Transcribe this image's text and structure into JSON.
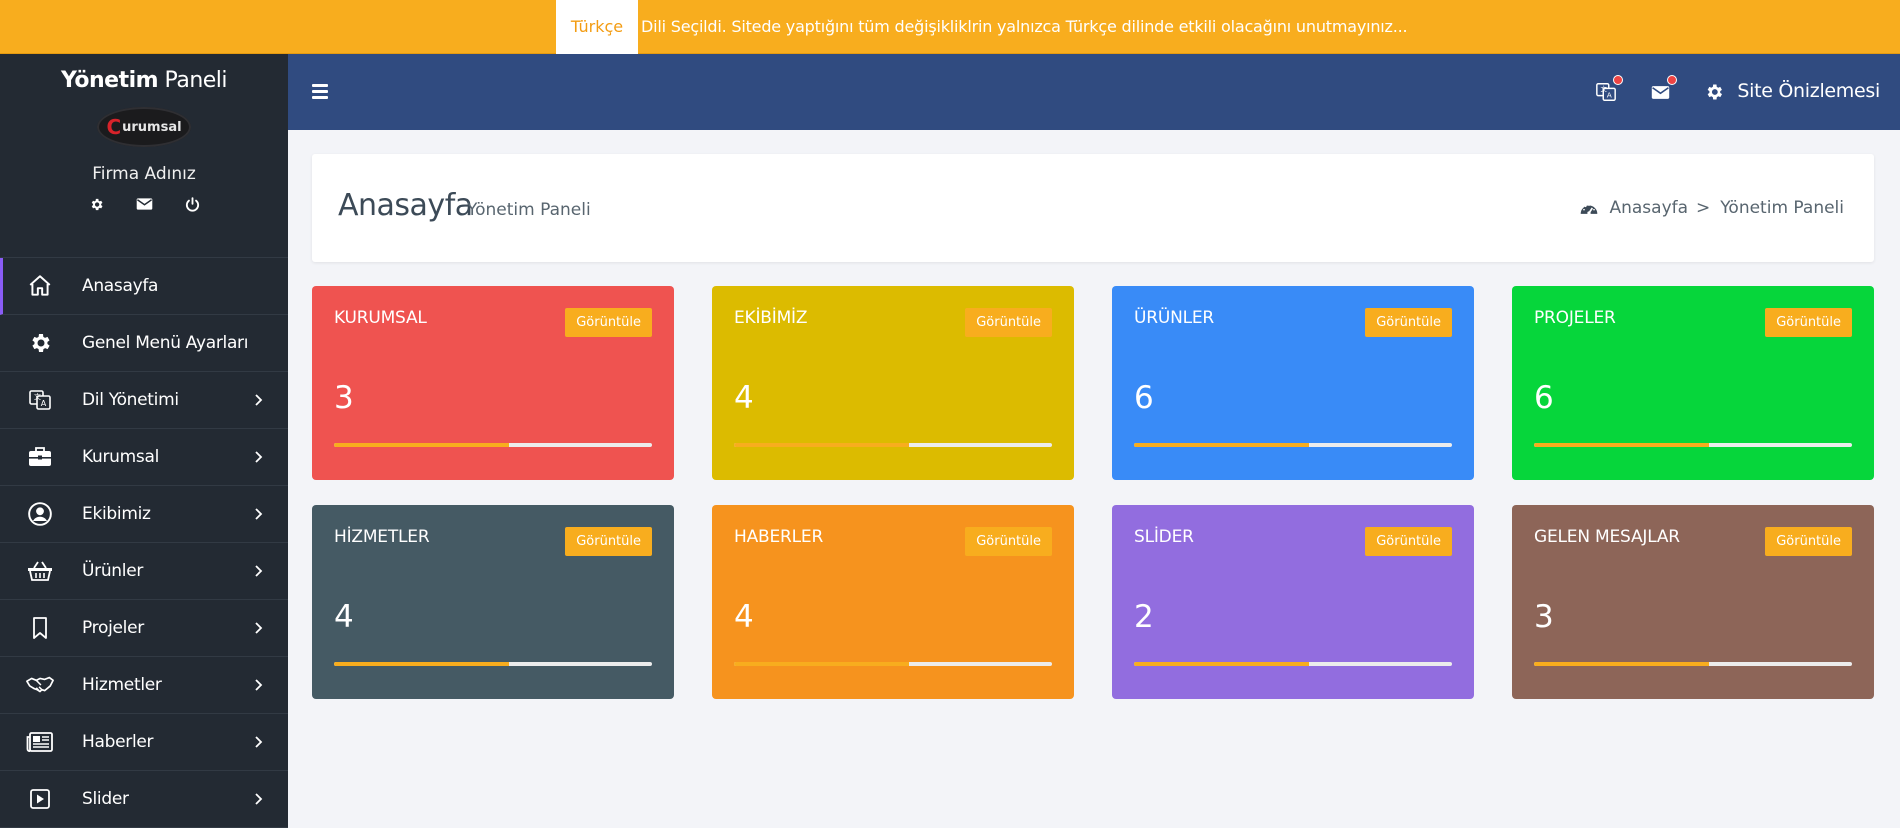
{
  "notice": {
    "lang": "Türkçe",
    "message": "Dili Seçildi. Sitede yaptığını tüm değişikliklrin yalnızca Türkçe dilinde etkili olacağını unutmayınız..."
  },
  "sidebar": {
    "title_bold": "Yönetim",
    "title_rest": " Paneli",
    "logo_mark": "C",
    "logo_text": "urumsal",
    "firm_name": "Firma Adınız",
    "items": [
      {
        "label": "Anasayfa",
        "icon": "home-icon"
      },
      {
        "label": "Genel Menü Ayarları",
        "icon": "gear-icon"
      },
      {
        "label": "Dil Yönetimi",
        "icon": "translate-icon"
      },
      {
        "label": "Kurumsal",
        "icon": "briefcase-icon"
      },
      {
        "label": "Ekibimiz",
        "icon": "user-circle-icon"
      },
      {
        "label": "Ürünler",
        "icon": "basket-icon"
      },
      {
        "label": "Projeler",
        "icon": "bookmark-icon"
      },
      {
        "label": "Hizmetler",
        "icon": "handshake-icon"
      },
      {
        "label": "Haberler",
        "icon": "newspaper-icon"
      },
      {
        "label": "Slider",
        "icon": "play-square-icon"
      }
    ]
  },
  "header": {
    "preview_label": "Site Önizlemesi"
  },
  "page": {
    "title": "Anasayfa",
    "subtitle": "Yönetim Paneli",
    "breadcrumb": [
      "Anasayfa",
      ">",
      "Yönetim Paneli"
    ]
  },
  "cards": [
    {
      "name": "KURUMSAL",
      "count": "3",
      "button": "Görüntüle",
      "color": "#ef5350",
      "progress": 0.55
    },
    {
      "name": "EKİBİMİZ",
      "count": "4",
      "button": "Görüntüle",
      "color": "#dcbb00",
      "progress": 0.55
    },
    {
      "name": "ÜRÜNLER",
      "count": "6",
      "button": "Görüntüle",
      "color": "#398bf7",
      "progress": 0.55
    },
    {
      "name": "PROJELER",
      "count": "6",
      "button": "Görüntüle",
      "color": "#06d63b",
      "progress": 0.55
    },
    {
      "name": "HİZMETLER",
      "count": "4",
      "button": "Görüntüle",
      "color": "#455a64",
      "progress": 0.55
    },
    {
      "name": "HABERLER",
      "count": "4",
      "button": "Görüntüle",
      "color": "#f6931e",
      "progress": 0.55
    },
    {
      "name": "SLİDER",
      "count": "2",
      "button": "Görüntüle",
      "color": "#926ddf",
      "progress": 0.55
    },
    {
      "name": "GELEN MESAJLAR",
      "count": "3",
      "button": "Görüntüle",
      "color": "#8d6558",
      "progress": 0.55
    }
  ],
  "colors": {
    "accent": "#f8ad1e",
    "sidebar": "#232a33",
    "header": "#304b80",
    "active_border": "#8a5cf6"
  }
}
